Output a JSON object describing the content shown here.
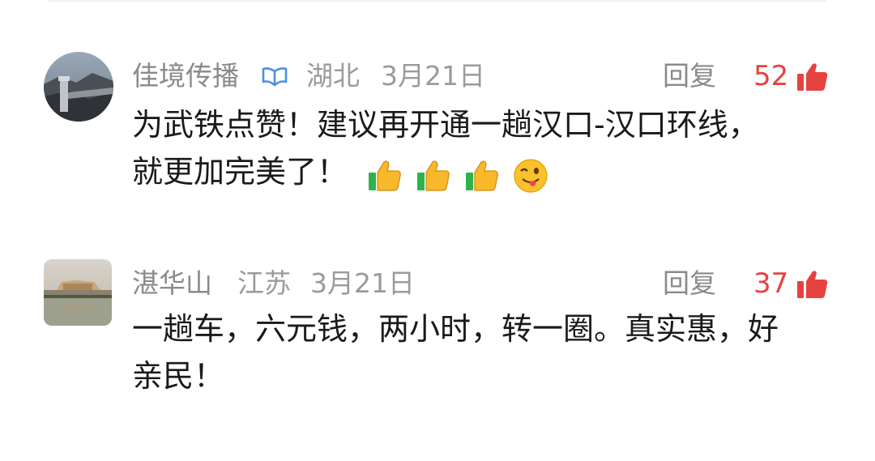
{
  "comments": [
    {
      "username": "佳境传播",
      "verified": true,
      "location": "湖北",
      "date": "3月21日",
      "reply_label": "回复",
      "likes": "52",
      "text_line1": "为武铁点赞！建议再开通一趟汉口-汉口环线，",
      "text_line2": "就更加完美了！",
      "emojis": [
        "thumbs-up-icon",
        "thumbs-up-icon",
        "thumbs-up-icon",
        "winking-tongue-face-icon"
      ]
    },
    {
      "username": "湛华山",
      "verified": false,
      "location": "江苏",
      "date": "3月21日",
      "reply_label": "回复",
      "likes": "37",
      "text_line1": "一趟车，六元钱，两小时，转一圈。真实惠，好",
      "text_line2": "亲民！"
    }
  ],
  "colors": {
    "like_count": "#e64340",
    "like_icon": "#e64340",
    "verified_badge": "#4a90e2",
    "meta_text": "#9b9b9b",
    "body_text": "#1a1a1a"
  }
}
